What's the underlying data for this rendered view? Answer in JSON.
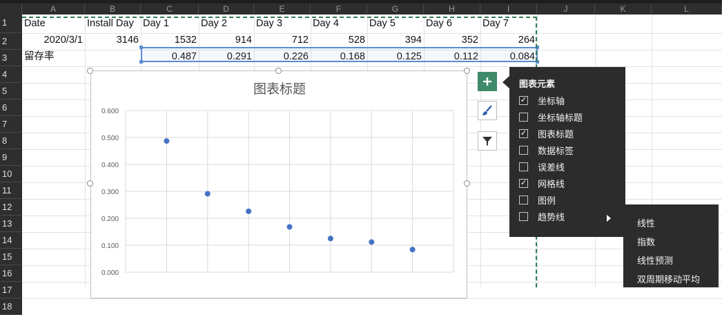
{
  "columns": [
    "A",
    "B",
    "C",
    "D",
    "E",
    "F",
    "G",
    "H",
    "I",
    "J",
    "K",
    "L"
  ],
  "rows": [
    "1",
    "2",
    "3",
    "4",
    "5",
    "6",
    "7",
    "8",
    "9",
    "10",
    "11",
    "12",
    "13",
    "14",
    "15",
    "16",
    "17",
    "18"
  ],
  "sheet": {
    "row1": [
      "Date",
      "Install Day",
      "Day 1",
      "Day 2",
      "Day 3",
      "Day 4",
      "Day 5",
      "Day 6",
      "Day 7"
    ],
    "row2": [
      "2020/3/1",
      "3146",
      "1532",
      "914",
      "712",
      "528",
      "394",
      "352",
      "264"
    ],
    "row3": [
      "留存率",
      "",
      "0.487",
      "0.291",
      "0.226",
      "0.168",
      "0.125",
      "0.112",
      "0.084"
    ]
  },
  "chart_data": {
    "type": "scatter",
    "title": "图表标题",
    "x": [
      1,
      2,
      3,
      4,
      5,
      6,
      7
    ],
    "y": [
      0.487,
      0.291,
      0.226,
      0.168,
      0.125,
      0.112,
      0.084
    ],
    "ylim": [
      0,
      0.6
    ],
    "yticks": [
      "0.600",
      "0.500",
      "0.400",
      "0.300",
      "0.200",
      "0.100",
      "0.000"
    ],
    "grid": true,
    "point_color": "#4472c4"
  },
  "chart_elements_panel": {
    "title": "图表元素",
    "options": [
      {
        "label": "坐标轴",
        "checked": true
      },
      {
        "label": "坐标轴标题",
        "checked": false
      },
      {
        "label": "图表标题",
        "checked": true
      },
      {
        "label": "数据标签",
        "checked": false
      },
      {
        "label": "误差线",
        "checked": false
      },
      {
        "label": "网格线",
        "checked": true
      },
      {
        "label": "图例",
        "checked": false
      },
      {
        "label": "趋势线",
        "checked": false
      }
    ],
    "trendline_submenu": [
      "线性",
      "指数",
      "线性预测",
      "双周期移动平均"
    ]
  },
  "side_buttons": [
    "plus-icon",
    "brush-icon",
    "filter-icon"
  ],
  "colors": {
    "accent_green": "#3f8a6a",
    "selection_blue": "#5b8bd0",
    "copy_dash_green": "#2e7d52"
  }
}
